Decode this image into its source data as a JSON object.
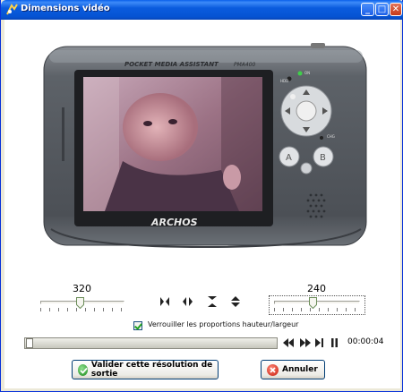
{
  "window": {
    "title": "Dimensions vidéo",
    "controls": [
      "minimize-icon",
      "maximize-icon",
      "close-icon"
    ]
  },
  "device": {
    "brand": "ARCHOS",
    "subtitle": "POCKET MEDIA ASSISTANT",
    "model": "PMA400",
    "led_labels": [
      "HDD",
      "ON",
      "CHG"
    ],
    "key_labels": [
      "A",
      "B"
    ],
    "screen_content": "video preview"
  },
  "width_control": {
    "value": "320"
  },
  "height_control": {
    "value": "240"
  },
  "transform_icons": [
    "flip-horizontal-icon",
    "mirror-horizontal-icon",
    "flip-vertical-icon",
    "mirror-vertical-icon"
  ],
  "lock_ratio": {
    "checked": true,
    "label": "Verrouiller les proportions hauteur/largeur"
  },
  "playback": {
    "position": 0.0,
    "time": "00:00:04",
    "buttons": [
      "rewind-icon",
      "play-icon",
      "skip-end-icon",
      "pause-icon"
    ]
  },
  "actions": {
    "ok_label": "Valider cette résolution de sortie",
    "cancel_label": "Annuler"
  },
  "colors": {
    "titlebar": "#0553d3",
    "device_body": "#5a5f66",
    "screen_tint": "#b0899b"
  }
}
